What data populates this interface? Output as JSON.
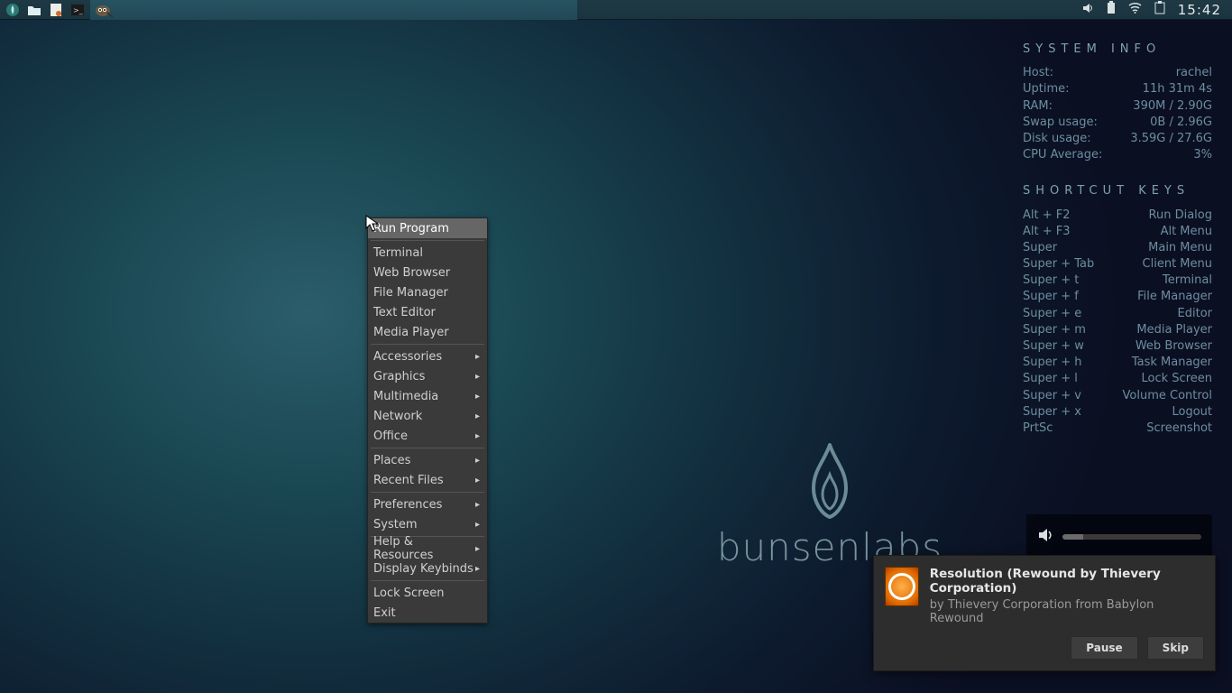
{
  "panel": {
    "task_title": "",
    "clock": "15:42",
    "launchers": [
      "menu",
      "files",
      "browser",
      "terminal"
    ],
    "tray": [
      "volume",
      "battery",
      "wifi",
      "clipboard"
    ]
  },
  "conky": {
    "sysinfo_heading": "SYSTEM INFO",
    "sys": [
      {
        "k": "Host:",
        "v": "rachel"
      },
      {
        "k": "Uptime:",
        "v": "11h 31m 4s"
      },
      {
        "k": "RAM:",
        "v": "390M / 2.90G"
      },
      {
        "k": "Swap usage:",
        "v": "0B / 2.96G"
      },
      {
        "k": "Disk usage:",
        "v": "3.59G / 27.6G"
      },
      {
        "k": "CPU Average:",
        "v": "3%"
      }
    ],
    "keys_heading": "SHORTCUT KEYS",
    "keys": [
      {
        "k": "Alt + F2",
        "v": "Run Dialog"
      },
      {
        "k": "Alt + F3",
        "v": "Alt Menu"
      },
      {
        "k": "Super",
        "v": "Main Menu"
      },
      {
        "k": "Super + Tab",
        "v": "Client Menu"
      },
      {
        "k": "Super + t",
        "v": "Terminal"
      },
      {
        "k": "Super + f",
        "v": "File Manager"
      },
      {
        "k": "Super + e",
        "v": "Editor"
      },
      {
        "k": "Super + m",
        "v": "Media Player"
      },
      {
        "k": "Super + w",
        "v": "Web Browser"
      },
      {
        "k": "Super + h",
        "v": "Task Manager"
      },
      {
        "k": "Super + l",
        "v": "Lock Screen"
      },
      {
        "k": "Super + v",
        "v": "Volume Control"
      },
      {
        "k": "Super + x",
        "v": "Logout"
      },
      {
        "k": "PrtSc",
        "v": "Screenshot"
      }
    ]
  },
  "logo_text": "bunsenlabs",
  "menu": {
    "groups": [
      [
        {
          "label": "Run Program",
          "sub": false,
          "hover": true
        }
      ],
      [
        {
          "label": "Terminal",
          "sub": false
        },
        {
          "label": "Web Browser",
          "sub": false
        },
        {
          "label": "File Manager",
          "sub": false
        },
        {
          "label": "Text Editor",
          "sub": false
        },
        {
          "label": "Media Player",
          "sub": false
        }
      ],
      [
        {
          "label": "Accessories",
          "sub": true
        },
        {
          "label": "Graphics",
          "sub": true
        },
        {
          "label": "Multimedia",
          "sub": true
        },
        {
          "label": "Network",
          "sub": true
        },
        {
          "label": "Office",
          "sub": true
        }
      ],
      [
        {
          "label": "Places",
          "sub": true
        },
        {
          "label": "Recent Files",
          "sub": true
        }
      ],
      [
        {
          "label": "Preferences",
          "sub": true
        },
        {
          "label": "System",
          "sub": true
        }
      ],
      [
        {
          "label": "Help & Resources",
          "sub": true
        },
        {
          "label": "Display Keybinds",
          "sub": true
        }
      ],
      [
        {
          "label": "Lock Screen",
          "sub": false
        },
        {
          "label": "Exit",
          "sub": false
        }
      ]
    ]
  },
  "notification": {
    "title": "Resolution (Rewound by Thievery Corporation)",
    "subtitle": "by Thievery Corporation from Babylon Rewound",
    "pause": "Pause",
    "skip": "Skip"
  }
}
